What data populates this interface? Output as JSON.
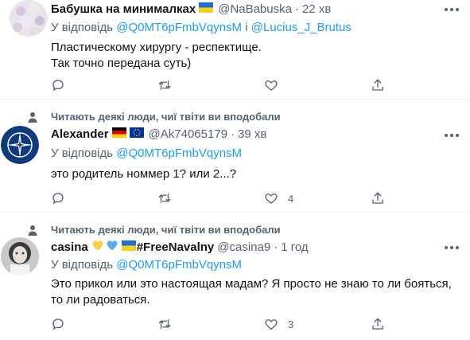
{
  "tweets": [
    {
      "name": "Бабушка на минималках",
      "handle": "@NaBabuska",
      "time": "22 хв",
      "reply_prefix": "У відповідь",
      "reply_to_1": "@Q0MT6pFmbVqynsM",
      "reply_joiner": "і",
      "reply_to_2": "@Lucius_J_Brutus",
      "text_line1": "Пластическому хирургу - респектище.",
      "text_line2": "Так точно передана суть)",
      "like_count": ""
    },
    {
      "social_context": "Читають деякі люди, чиї твіти ви вподобали",
      "name": "Alexander",
      "handle": "@Ak74065179",
      "time": "39 хв",
      "reply_prefix": "У відповідь",
      "reply_to_1": "@Q0MT6pFmbVqynsM",
      "text_line1": "это родитель номмер 1? или 2...?",
      "like_count": "4"
    },
    {
      "social_context": "Читають деякі люди, чиї твіти ви вподобали",
      "name": "casina",
      "name_suffix": "#FreeNavalny",
      "handle": "@casina9",
      "time": "1 год",
      "reply_prefix": "У відповідь",
      "reply_to_1": "@Q0MT6pFmbVqynsM",
      "text_line1": "Это прикол или это настоящая мадам? Я просто не знаю то ли бояться,",
      "text_line2": "то ли радоваться.",
      "like_count": "3"
    }
  ],
  "icons": {
    "reply": "reply-icon",
    "retweet": "retweet-icon",
    "like": "heart-icon",
    "share": "share-icon",
    "more": "more-icon",
    "context": "person-icon"
  },
  "colors": {
    "mention": "#1d9bf0",
    "secondary": "#536471",
    "primary_text": "#0f1419",
    "separator": "#eff3f4"
  }
}
